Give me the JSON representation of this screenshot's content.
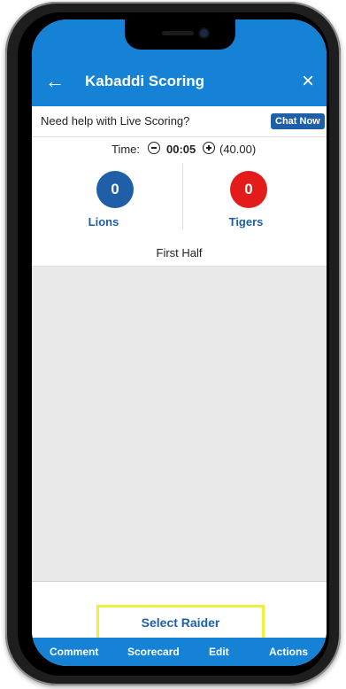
{
  "header": {
    "title": "Kabaddi Scoring",
    "back_icon": "arrow-left-icon",
    "close_icon": "close-icon"
  },
  "help": {
    "text": "Need help with Live Scoring?",
    "chat_label": "Chat Now"
  },
  "timer": {
    "label": "Time:",
    "value": "00:05",
    "total": "(40.00)"
  },
  "teams": [
    {
      "name": "Lions",
      "score": "0",
      "color": "#1e5fa8"
    },
    {
      "name": "Tigers",
      "score": "0",
      "color": "#e31b1b"
    }
  ],
  "half": "First Half",
  "action": {
    "select_raider": "Select Raider"
  },
  "bottom_nav": [
    "Comment",
    "Scorecard",
    "Edit",
    "Actions"
  ],
  "colors": {
    "primary": "#1582d6",
    "team_blue": "#1e5fa8",
    "team_red": "#e31b1b",
    "highlight": "#f0f03a"
  }
}
